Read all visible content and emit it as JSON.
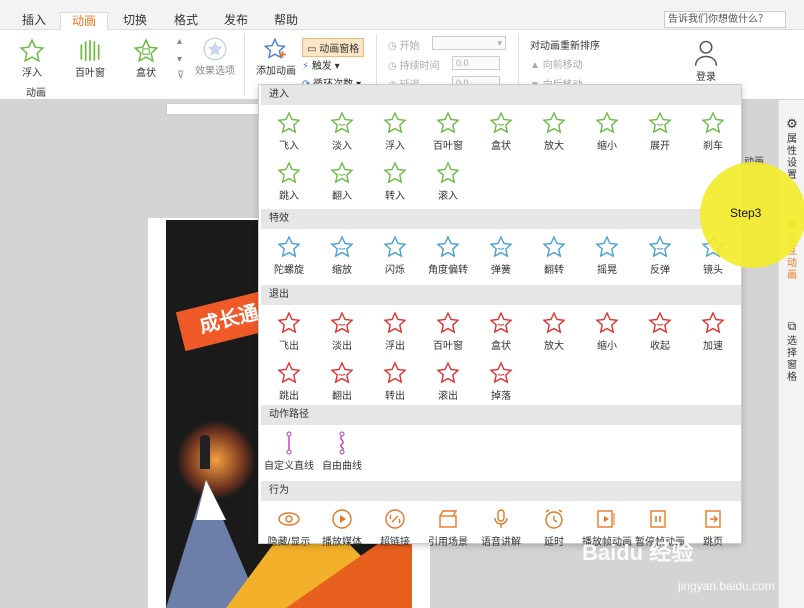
{
  "menu": {
    "tabs": [
      "插入",
      "动画",
      "切换",
      "格式",
      "发布",
      "帮助"
    ],
    "active": "动画",
    "help_placeholder": "告诉我们你想做什么？"
  },
  "ribbon": {
    "presets": [
      "浮入",
      "百叶窗",
      "盒状"
    ],
    "effect_options": "效果选项",
    "group_label": "动画",
    "add_animation": "添加动画",
    "animation_pane": "动画窗格",
    "trigger": "触发",
    "loop": "循环次数",
    "start": "开始",
    "duration": "持续时间",
    "delay": "延迟",
    "duration_value": "0.0",
    "delay_value": "0.0",
    "reorder_title": "对动画重新排序",
    "move_forward": "向前移动",
    "move_back": "向后移动",
    "login": "登录"
  },
  "panel": {
    "sections": [
      {
        "title": "进入",
        "items": [
          "飞入",
          "淡入",
          "浮入",
          "百叶窗",
          "盒状",
          "放大",
          "缩小",
          "展开",
          "刹车",
          "跳入",
          "翻入",
          "转入",
          "滚入"
        ]
      },
      {
        "title": "特效",
        "items": [
          "陀螺旋",
          "缩放",
          "闪烁",
          "角度偏转",
          "弹簧",
          "翻转",
          "摇晃",
          "反弹",
          "镜头"
        ]
      },
      {
        "title": "退出",
        "items": [
          "飞出",
          "淡出",
          "浮出",
          "百叶窗",
          "盒状",
          "放大",
          "缩小",
          "收起",
          "加速",
          "跳出",
          "翻出",
          "转出",
          "滚出",
          "掉落"
        ]
      },
      {
        "title": "动作路径",
        "items": [
          "自定义直线",
          "自由曲线"
        ]
      },
      {
        "title": "行为",
        "items": [
          "隐藏/显示",
          "播放媒体",
          "超链接",
          "引用场景",
          "语音讲解",
          "延时",
          "播放帧动画",
          "暂停帧动画",
          "跳页"
        ]
      }
    ],
    "partial_label": "动画"
  },
  "right_sidebar": {
    "items": [
      "属性设置",
      "交互动画",
      "选择窗格"
    ],
    "active": "交互动画"
  },
  "slide": {
    "banner_text": "成长通"
  },
  "overlay": {
    "step": "Step3"
  },
  "watermark": {
    "text": "Baidu 经验",
    "url": "jingyan.baidu.com"
  },
  "colors": {
    "accent": "#e87722",
    "enter": "#6dbb45",
    "effect": "#4a9fd4",
    "exit": "#e03030",
    "path": "#c03cc0",
    "behavior": "#e87722",
    "highlight": "#f4ec2c"
  }
}
